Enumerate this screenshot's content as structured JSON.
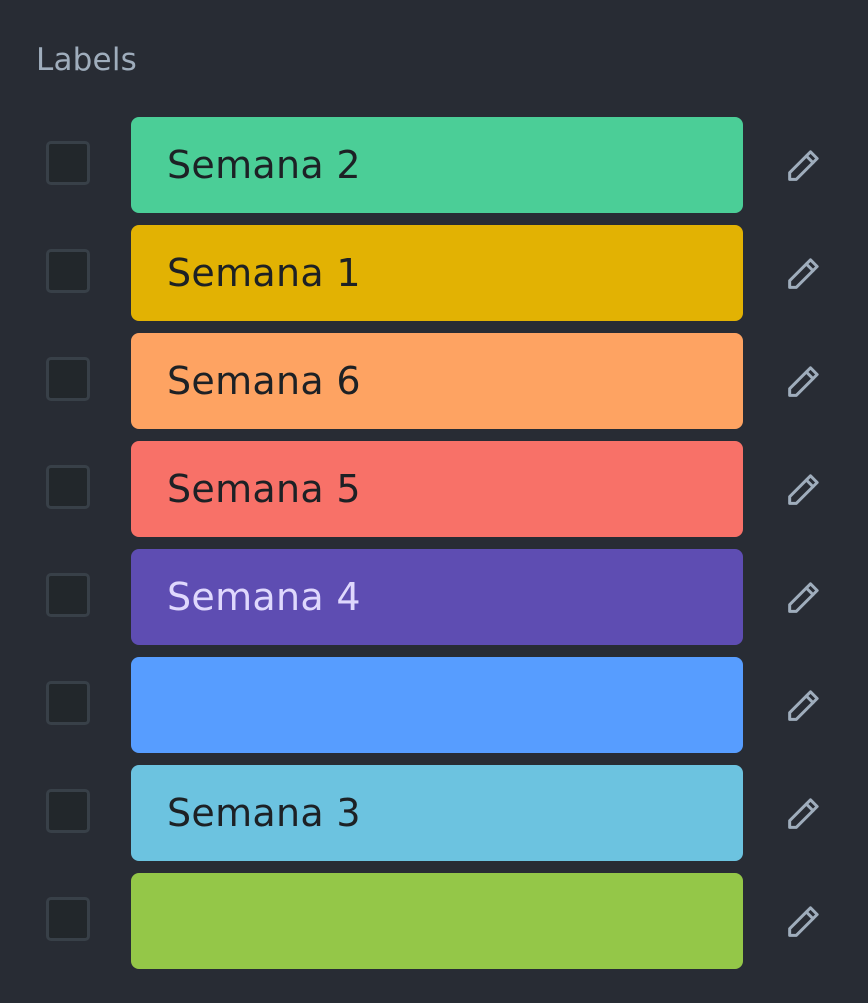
{
  "panel": {
    "title": "Labels"
  },
  "labels": [
    {
      "text": "Semana 2",
      "color": "#4bce97",
      "text_color": "#1d2125"
    },
    {
      "text": "Semana 1",
      "color": "#e2b203",
      "text_color": "#1d2125"
    },
    {
      "text": "Semana 6",
      "color": "#fea362",
      "text_color": "#1d2125"
    },
    {
      "text": "Semana 5",
      "color": "#f87168",
      "text_color": "#1d2125"
    },
    {
      "text": "Semana 4",
      "color": "#5e4db2",
      "text_color": "#dfd8fd"
    },
    {
      "text": "",
      "color": "#579dff",
      "text_color": "#1d2125"
    },
    {
      "text": "Semana 3",
      "color": "#6cc3e0",
      "text_color": "#1d2125"
    },
    {
      "text": "",
      "color": "#94c748",
      "text_color": "#1d2125"
    }
  ],
  "icons": {
    "checkbox": "checkbox-empty",
    "edit": "pencil-icon"
  },
  "colors": {
    "background": "#282c34",
    "title": "#9fadbc",
    "checkbox_border": "#384048",
    "checkbox_fill": "#22272b",
    "icon": "#9fadbc"
  }
}
